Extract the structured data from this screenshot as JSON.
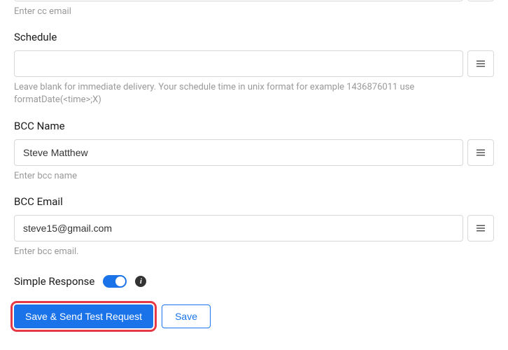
{
  "cc_email": {
    "helper": "Enter cc email"
  },
  "schedule": {
    "label": "Schedule",
    "value": "",
    "helper": "Leave blank for immediate delivery. Your schedule time in unix format for example 1436876011 use formatDate(<time>;X)"
  },
  "bcc_name": {
    "label": "BCC Name",
    "value": "Steve Matthew",
    "helper": "Enter bcc name"
  },
  "bcc_email": {
    "label": "BCC Email",
    "value": "steve15@gmail.com",
    "helper": "Enter bcc email."
  },
  "simple_response": {
    "label": "Simple Response",
    "enabled": true
  },
  "buttons": {
    "save_send_test": "Save & Send Test Request",
    "save": "Save"
  }
}
